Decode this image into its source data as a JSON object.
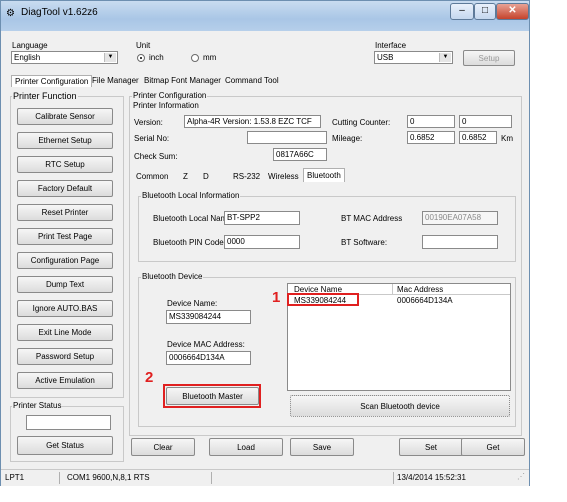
{
  "window": {
    "title": "DiagTool v1.62z6"
  },
  "language": {
    "label": "Language",
    "value": "English"
  },
  "unit": {
    "label": "Unit",
    "inch": "inch",
    "mm": "mm"
  },
  "interface": {
    "label": "Interface",
    "value": "USB",
    "setup": "Setup"
  },
  "tabs": [
    "Printer Configuration",
    "File Manager",
    "Bitmap Font Manager",
    "Command Tool"
  ],
  "printer_function": {
    "label": "Printer Function",
    "buttons": [
      "Calibrate Sensor",
      "Ethernet Setup",
      "RTC Setup",
      "Factory Default",
      "Reset Printer",
      "Print Test Page",
      "Configuration Page",
      "Dump Text",
      "Ignore AUTO.BAS",
      "Exit Line Mode",
      "Password Setup",
      "Active Emulation"
    ]
  },
  "printer_status": {
    "label": "Printer Status",
    "get_status": "Get Status"
  },
  "printer_config": {
    "label": "Printer Configuration",
    "info_label": "Printer Information"
  },
  "info": {
    "version_label": "Version:",
    "version_value": "Alpha-4R Version: 1.53.8 EZC TCF",
    "serial_label": "Serial No:",
    "serial_value": "",
    "checksum_label": "Check Sum:",
    "checksum_value": "0817A66C",
    "cutting_label": "Cutting Counter:",
    "cutting_a": "0",
    "cutting_b": "0",
    "mileage_label": "Mileage:",
    "mileage_a": "0.6852",
    "mileage_b": "0.6852",
    "mileage_unit": "Km"
  },
  "sub_tabs": [
    "Common",
    "Z",
    "D",
    "RS-232",
    "Wireless",
    "Bluetooth"
  ],
  "bt_local": {
    "label": "Bluetooth Local Information",
    "name_label": "Bluetooth Local Nam",
    "name_value": "BT-SPP2",
    "pin_label": "Bluetooth PIN Code",
    "pin_value": "0000",
    "mac_label": "BT MAC Address",
    "mac_value": "00190EA07A58",
    "sw_label": "BT Software:",
    "sw_value": ""
  },
  "bt_device": {
    "label": "Bluetooth Device",
    "name_label": "Device Name:",
    "name_value": "MS339084244",
    "mac_label": "Device MAC Address:",
    "mac_value": "0006664D134A",
    "master_button": "Bluetooth Master",
    "scan_button": "Scan Bluetooth device",
    "columns": [
      "Device Name",
      "Mac Address"
    ],
    "rows": [
      {
        "name": "MS339084244",
        "mac": "0006664D134A"
      }
    ]
  },
  "annotations": {
    "one": "1",
    "two": "2"
  },
  "bottom_buttons": {
    "clear": "Clear",
    "load": "Load",
    "save": "Save",
    "set": "Set",
    "get": "Get"
  },
  "statusbar": {
    "port": "LPT1",
    "com": "COM1 9600,N,8,1 RTS",
    "datetime": "13/4/2014 15:52:31"
  },
  "colors": {
    "accent": "#e02020",
    "title_bar": "#b6cfea"
  }
}
